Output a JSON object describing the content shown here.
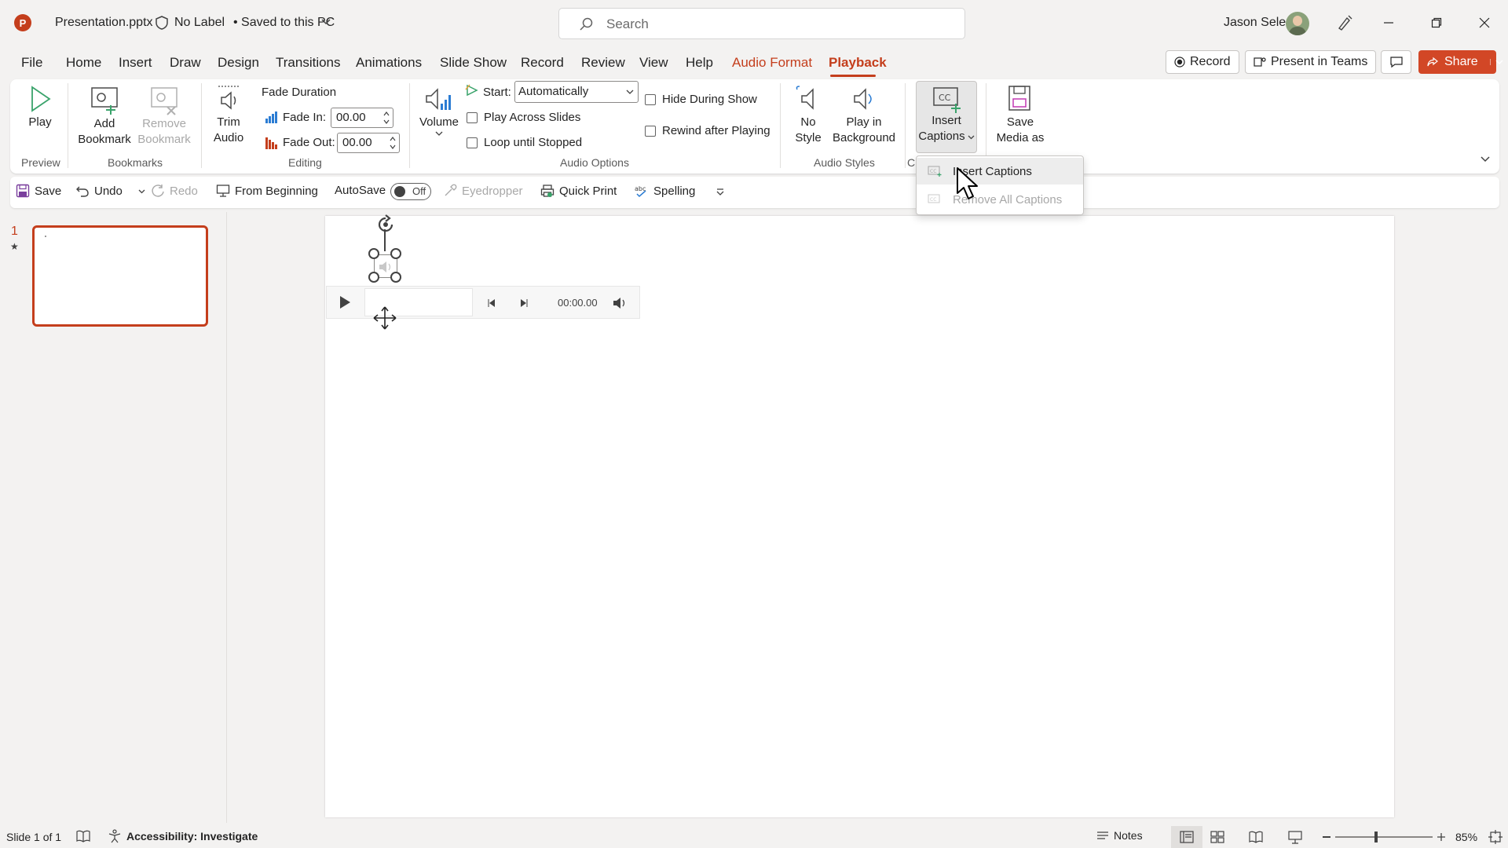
{
  "titlebar": {
    "app_letter": "P",
    "file_name": "Presentation.pptx",
    "label_status": "No Label",
    "save_status": "• Saved to this PC",
    "search_placeholder": "Search",
    "user_name": "Jason Sele"
  },
  "tabs": [
    "File",
    "Home",
    "Insert",
    "Draw",
    "Design",
    "Transitions",
    "Animations",
    "Slide Show",
    "Record",
    "Review",
    "View",
    "Help",
    "Audio Format",
    "Playback"
  ],
  "top_buttons": {
    "record": "Record",
    "present_in_teams": "Present in Teams",
    "share": "Share"
  },
  "ribbon": {
    "preview": {
      "play": "Play",
      "group": "Preview"
    },
    "bookmarks": {
      "add": [
        "Add",
        "Bookmark"
      ],
      "remove": [
        "Remove",
        "Bookmark"
      ],
      "group": "Bookmarks"
    },
    "editing": {
      "trim": [
        "Trim",
        "Audio"
      ],
      "fade_duration": "Fade Duration",
      "fade_in_label": "Fade In:",
      "fade_in_value": "00.00",
      "fade_out_label": "Fade Out:",
      "fade_out_value": "00.00",
      "group": "Editing"
    },
    "audio_options": {
      "volume": "Volume",
      "start_label": "Start:",
      "start_value": "Automatically",
      "play_across": "Play Across Slides",
      "loop": "Loop until Stopped",
      "hide": "Hide During Show",
      "rewind": "Rewind after Playing",
      "group": "Audio Options"
    },
    "audio_styles": {
      "no_style": [
        "No",
        "Style"
      ],
      "play_bg": [
        "Play in",
        "Background"
      ],
      "group": "Audio Styles"
    },
    "captions": {
      "insert": [
        "Insert",
        "Captions"
      ],
      "group_partial": "C"
    },
    "save_media": [
      "Save",
      "Media as"
    ]
  },
  "qat": {
    "save": "Save",
    "undo": "Undo",
    "redo": "Redo",
    "from_beginning": "From Beginning",
    "autosave": "AutoSave",
    "autosave_state": "Off",
    "eyedropper": "Eyedropper",
    "quick_print": "Quick Print",
    "spelling": "Spelling"
  },
  "thumbnails": {
    "slide_number": "1",
    "star": "★"
  },
  "player": {
    "time": "00:00.00"
  },
  "dropdown": {
    "insert_captions": "Insert Captions",
    "remove_all_captions": "Remove All Captions"
  },
  "status": {
    "slide_info": "Slide 1 of 1",
    "accessibility": "Accessibility: Investigate",
    "notes": "Notes",
    "zoom": "85%"
  },
  "colors": {
    "accent": "#c43e1c",
    "share": "#d24726"
  }
}
